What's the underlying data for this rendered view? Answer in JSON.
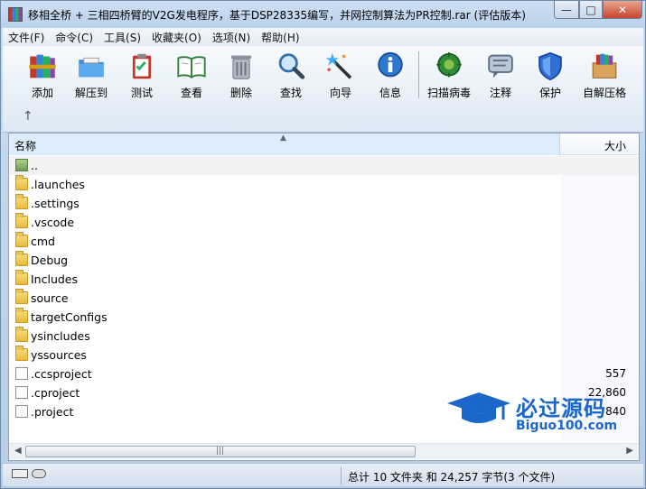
{
  "window": {
    "title": "移相全桥 + 三相四桥臂的V2G发电程序，基于DSP28335编写，并网控制算法为PR控制.rar (评估版本)",
    "minimize": "—",
    "maximize": "□",
    "close": "✕"
  },
  "menu": [
    "文件(F)",
    "命令(C)",
    "工具(S)",
    "收藏夹(O)",
    "选项(N)",
    "帮助(H)"
  ],
  "toolbar": {
    "buttons": [
      {
        "label": "添加",
        "icon": "books-add-icon"
      },
      {
        "label": "解压到",
        "icon": "folder-extract-icon"
      },
      {
        "label": "测试",
        "icon": "clipboard-test-icon"
      },
      {
        "label": "查看",
        "icon": "book-view-icon"
      },
      {
        "label": "删除",
        "icon": "trash-icon"
      },
      {
        "label": "查找",
        "icon": "magnifier-icon"
      },
      {
        "label": "向导",
        "icon": "wand-icon"
      },
      {
        "label": "信息",
        "icon": "info-icon"
      },
      {
        "label": "扫描病毒",
        "icon": "virus-scan-icon"
      },
      {
        "label": "注释",
        "icon": "comment-icon"
      },
      {
        "label": "保护",
        "icon": "shield-icon"
      },
      {
        "label": "自解压格",
        "icon": "sfx-box-icon"
      }
    ],
    "up_arrow": "↑"
  },
  "list": {
    "col_name": "名称",
    "col_size": "大小",
    "sort_caret": "▲",
    "rows": [
      {
        "name": "..",
        "type": "up",
        "size": ""
      },
      {
        "name": ".launches",
        "type": "folder",
        "size": ""
      },
      {
        "name": ".settings",
        "type": "folder",
        "size": ""
      },
      {
        "name": ".vscode",
        "type": "folder",
        "size": ""
      },
      {
        "name": "cmd",
        "type": "folder",
        "size": ""
      },
      {
        "name": "Debug",
        "type": "folder",
        "size": ""
      },
      {
        "name": "Includes",
        "type": "folder",
        "size": ""
      },
      {
        "name": "source",
        "type": "folder",
        "size": ""
      },
      {
        "name": "targetConfigs",
        "type": "folder",
        "size": ""
      },
      {
        "name": "ysincludes",
        "type": "folder",
        "size": ""
      },
      {
        "name": "yssources",
        "type": "folder",
        "size": ""
      },
      {
        "name": ".ccsproject",
        "type": "file",
        "size": "557"
      },
      {
        "name": ".cproject",
        "type": "file",
        "size": "22,860"
      },
      {
        "name": ".project",
        "type": "file",
        "size": "840"
      }
    ]
  },
  "scrollbar": {
    "left": "◀",
    "right": "▶",
    "grip": "|||"
  },
  "watermark": {
    "title": "必过源码",
    "subtitle": "Biguo100.com"
  },
  "status": {
    "text": "总计 10 文件夹 和 24,257 字节(3 个文件)"
  },
  "colors": {
    "accent": "#1b66c9",
    "header_selected": "#dcecfc"
  }
}
